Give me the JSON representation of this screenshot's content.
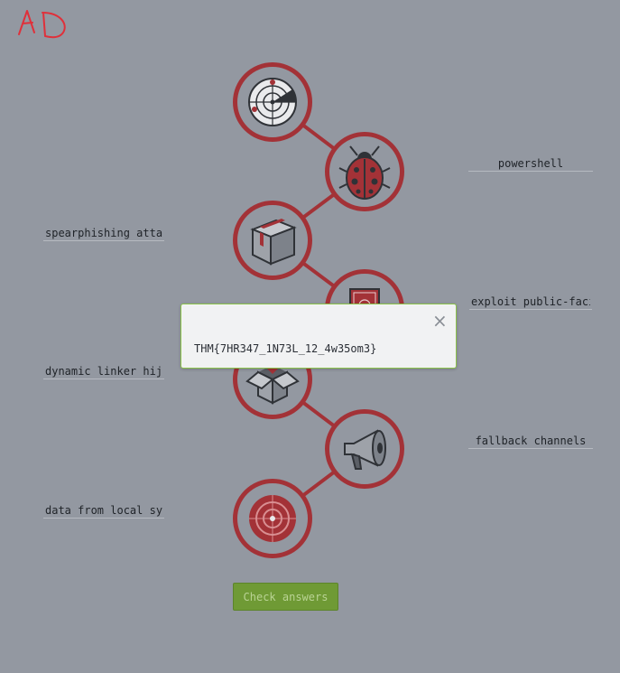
{
  "logo_text": "AD",
  "answers": [
    {
      "value": "powershell",
      "side": "right"
    },
    {
      "value": "spearphishing attachment",
      "side": "left"
    },
    {
      "value": "exploit public-facing application",
      "side": "right"
    },
    {
      "value": "dynamic linker hijacking",
      "side": "left"
    },
    {
      "value": "fallback channels",
      "side": "right"
    },
    {
      "value": "data from local system",
      "side": "left"
    }
  ],
  "icons": [
    "radar-icon",
    "ladybug-icon",
    "package-icon",
    "certificate-icon",
    "open-box-icon",
    "megaphone-icon",
    "target-icon"
  ],
  "check_button_label": "Check answers",
  "modal": {
    "close_glyph": "×",
    "message": "THM{7HR347_1N73L_12_4w35om3}"
  },
  "colors": {
    "background": "#9398a1",
    "ring": "#a33237",
    "icon_dark": "#2f3237",
    "button": "#6f9a35",
    "modal_border": "#8bc34a"
  }
}
